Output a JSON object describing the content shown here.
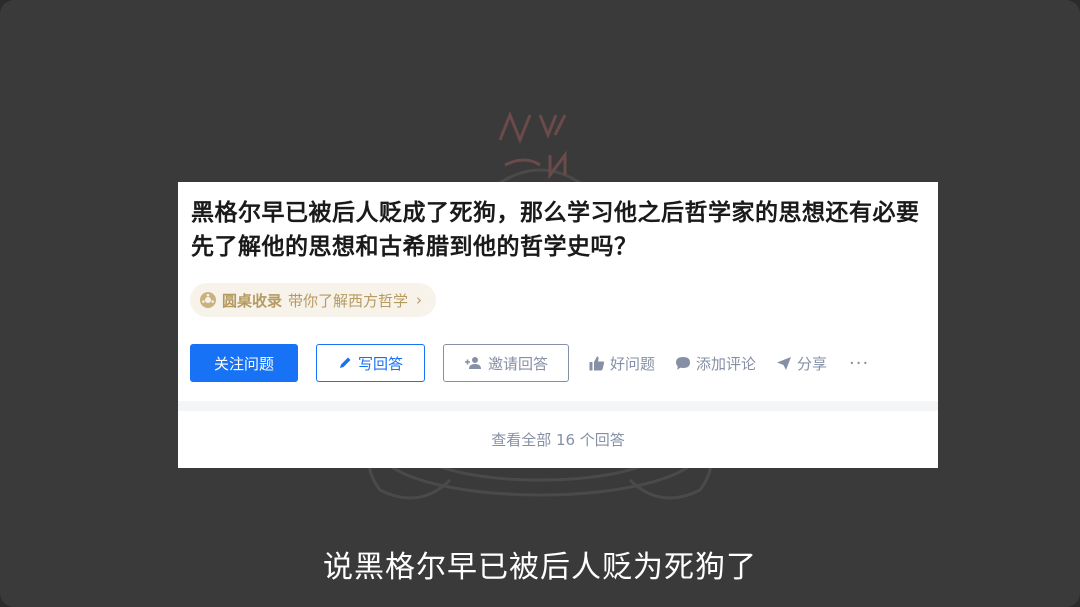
{
  "question": {
    "title": "黑格尔早已被后人贬成了死狗，那么学习他之后哲学家的思想还有必要先了解他的思想和古希腊到他的哲学史吗？"
  },
  "roundtable": {
    "label": "圆桌收录",
    "description": "带你了解西方哲学",
    "icon": "roundtable-icon"
  },
  "actions": {
    "follow_label": "关注问题",
    "write_label": "写回答",
    "invite_label": "邀请回答",
    "good_question_label": "好问题",
    "comment_label": "添加评论",
    "share_label": "分享",
    "more_label": "···"
  },
  "footer": {
    "view_all_label": "查看全部 16 个回答"
  },
  "subtitle": {
    "text": "说黑格尔早已被后人贬为死狗了"
  },
  "colors": {
    "primary": "#1772f6",
    "muted": "#8590a6",
    "roundtable_text": "#b59a62",
    "roundtable_bg": "#f7f3ea",
    "background": "#3a3a3a"
  }
}
